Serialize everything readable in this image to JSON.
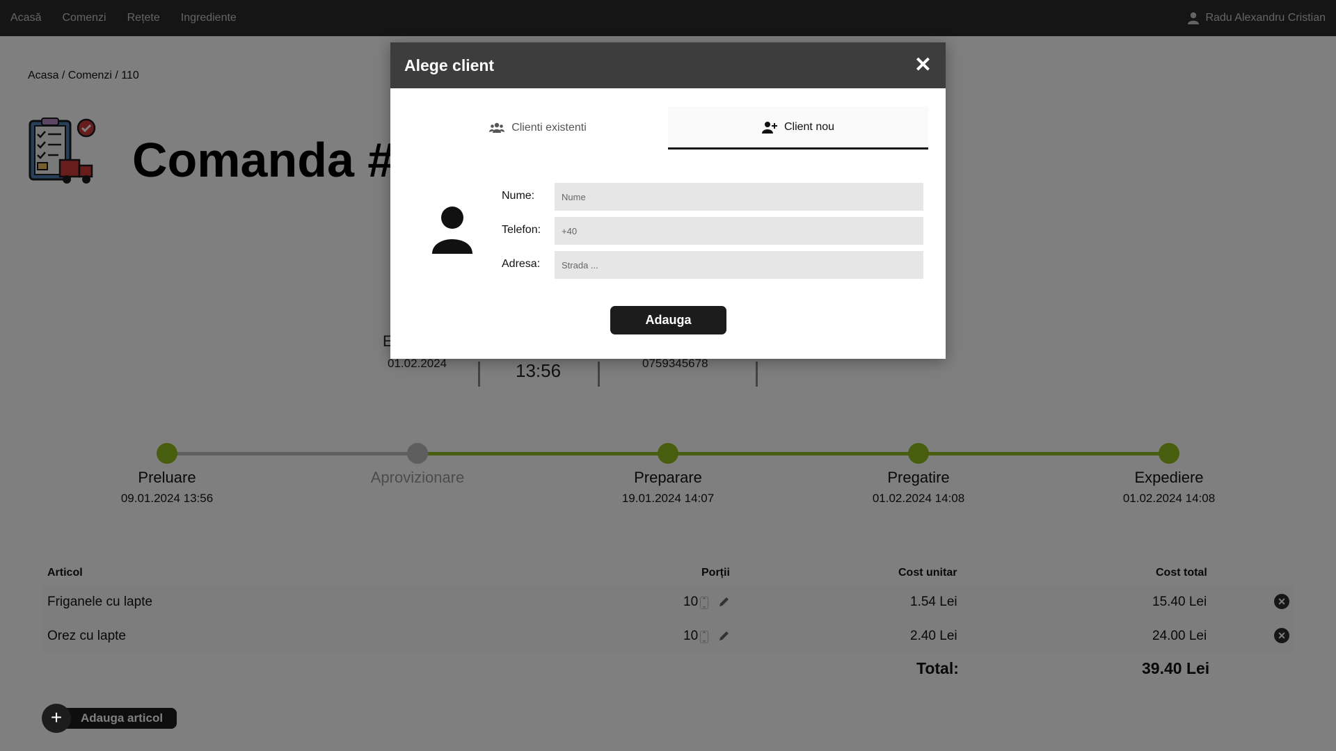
{
  "navbar": {
    "links": [
      "Acasă",
      "Comenzi",
      "Rețete",
      "Ingrediente"
    ],
    "user_name": "Radu Alexandru Cristian"
  },
  "breadcrumb": "Acasa / Comenzi / 110",
  "page": {
    "title": "Comanda #"
  },
  "info": {
    "partial_label": "E",
    "date": "01.02.2024",
    "time": "13:56",
    "phone": "0759345678"
  },
  "timeline": {
    "steps": [
      {
        "label": "Preluare",
        "date": "09.01.2024 13:56",
        "done": true
      },
      {
        "label": "Aprovizionare",
        "date": "",
        "done": false
      },
      {
        "label": "Preparare",
        "date": "19.01.2024 14:07",
        "done": true
      },
      {
        "label": "Pregatire",
        "date": "01.02.2024 14:08",
        "done": true
      },
      {
        "label": "Expediere",
        "date": "01.02.2024 14:08",
        "done": true
      }
    ],
    "colors": {
      "done": "#8fbc1e",
      "pending": "#bdbdbd"
    }
  },
  "table": {
    "headers": {
      "item": "Articol",
      "portions": "Porții",
      "unit_cost": "Cost unitar",
      "total_cost": "Cost total"
    },
    "rows": [
      {
        "item": "Friganele cu lapte",
        "portions": "10",
        "unit_cost": "1.54 Lei",
        "total_cost": "15.40 Lei"
      },
      {
        "item": "Orez cu lapte",
        "portions": "10",
        "unit_cost": "2.40 Lei",
        "total_cost": "24.00 Lei"
      }
    ],
    "total_label": "Total:",
    "total_value": "39.40 Lei"
  },
  "add_item_label": "Adauga articol",
  "modal": {
    "title": "Alege client",
    "close": "✕",
    "tabs": {
      "existing": "Clienti existenti",
      "new": "Client nou"
    },
    "form": {
      "name_label": "Nume:",
      "name_placeholder": "Nume",
      "phone_label": "Telefon:",
      "phone_placeholder": "+40",
      "address_label": "Adresa:",
      "address_placeholder": "Strada ..."
    },
    "submit_label": "Adauga"
  }
}
